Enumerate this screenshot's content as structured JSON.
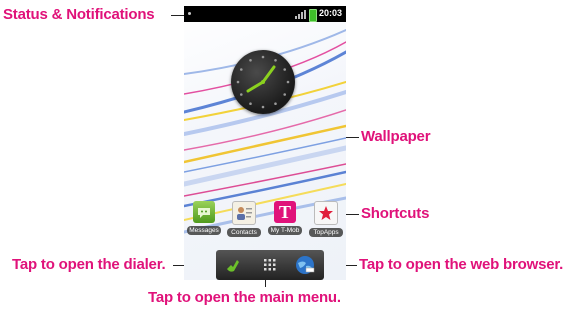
{
  "callouts": {
    "status": "Status & Notifications",
    "wallpaper": "Wallpaper",
    "shortcuts": "Shortcuts",
    "dialer": "Tap to open the dialer.",
    "browser": "Tap to open the web browser.",
    "menu": "Tap to open the main menu."
  },
  "status_bar": {
    "time": "20:03"
  },
  "shortcuts": [
    {
      "label": "Messages",
      "icon": "messages-icon"
    },
    {
      "label": "Contacts",
      "icon": "contacts-icon"
    },
    {
      "label": "My T-Mob",
      "icon": "tmobile-icon",
      "glyph": "T"
    },
    {
      "label": "TopApps",
      "icon": "topapps-icon"
    }
  ],
  "dock": [
    "phone-icon",
    "app-drawer-icon",
    "browser-icon"
  ],
  "colors": {
    "callout": "#e0127a",
    "tmobile": "#e0127a",
    "clock_hand": "#8bd11f"
  }
}
